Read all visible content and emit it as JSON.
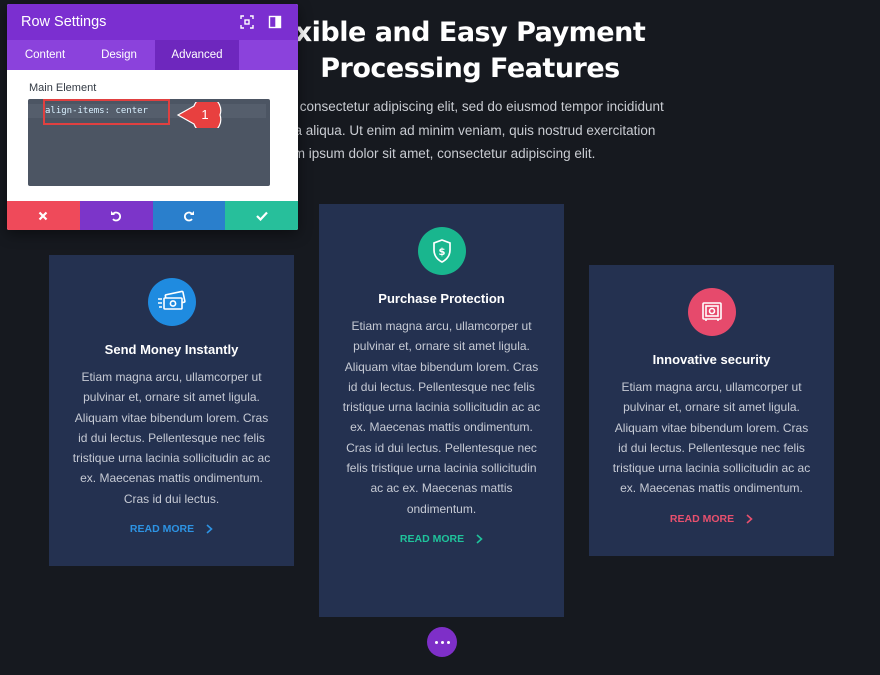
{
  "hero": {
    "title_line1": "xible and Easy Payment",
    "title_line2": "Processing Features",
    "paragraph": [
      "sit amet, consectetur adipiscing elit, sed do eiusmod tempor incididunt",
      "re magna aliqua. Ut enim ad minim veniam, quis nostrud exercitation",
      "co. Lorem ipsum dolor sit amet, consectetur adipiscing elit."
    ]
  },
  "cards": [
    {
      "title": "Send Money Instantly",
      "icon": "money-transfer-icon",
      "icon_color": "#1f8be0",
      "body": "Etiam magna arcu, ullamcorper ut pulvinar et, ornare sit amet ligula. Aliquam vitae bibendum lorem. Cras id dui lectus. Pellentesque nec felis tristique urna lacinia sollicitudin ac ac ex. Maecenas mattis ondimentum. Cras id dui lectus.",
      "link": "READ MORE",
      "link_color": "#2d93e3"
    },
    {
      "title": "Purchase Protection",
      "icon": "shield-dollar-icon",
      "icon_color": "#19b68e",
      "body": "Etiam magna arcu, ullamcorper ut pulvinar et, ornare sit amet ligula. Aliquam vitae bibendum lorem. Cras id dui lectus. Pellentesque nec felis tristique urna lacinia sollicitudin ac ac ex. Maecenas mattis ondimentum. Cras id dui lectus. Pellentesque nec felis tristique urna lacinia sollicitudin ac ac ex. Maecenas mattis ondimentum.",
      "link": "READ MORE",
      "link_color": "#1fc39b"
    },
    {
      "title": "Innovative security",
      "icon": "safe-icon",
      "icon_color": "#e64a6c",
      "body": "Etiam magna arcu, ullamcorper ut pulvinar et, ornare sit amet ligula. Aliquam vitae bibendum lorem. Cras id dui lectus. Pellentesque nec felis tristique urna lacinia sollicitudin ac ac ex. Maecenas mattis ondimentum.",
      "link": "READ MORE",
      "link_color": "#e8506e"
    }
  ],
  "modal": {
    "title": "Row Settings",
    "tabs": [
      "Content",
      "Design",
      "Advanced"
    ],
    "active_tab": "Advanced",
    "field_label": "Main Element",
    "code_value": "align-items: center",
    "footer_buttons": [
      "cancel-icon",
      "undo-icon",
      "redo-icon",
      "save-icon"
    ]
  },
  "callout": {
    "number": "1",
    "color": "#e8403f"
  },
  "fab": {
    "icon": "more-dots-icon",
    "color": "#7e2fc8"
  }
}
